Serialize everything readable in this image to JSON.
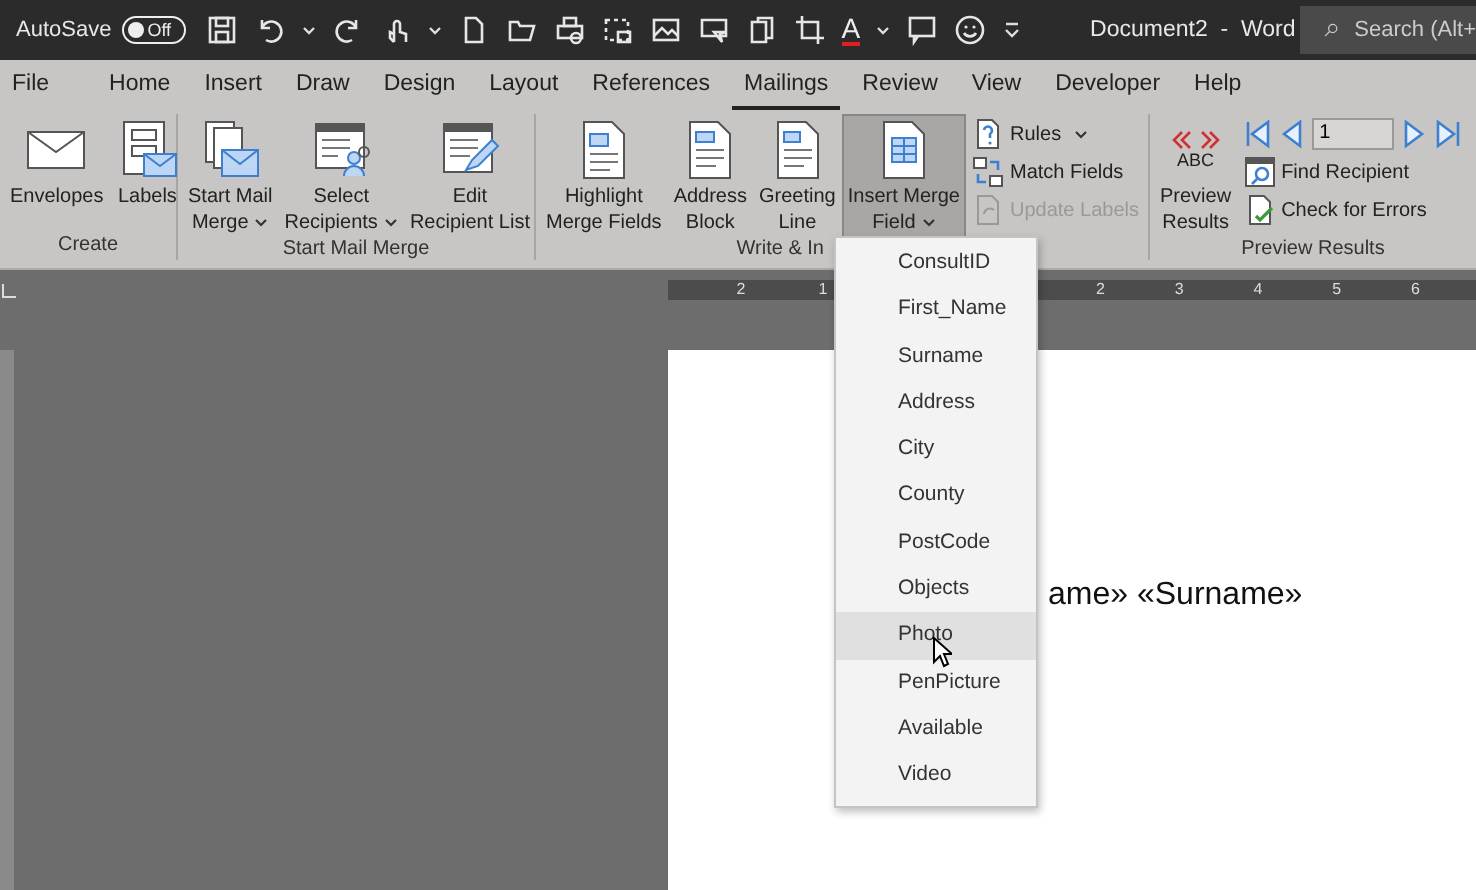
{
  "title_bar": {
    "autosave_label": "AutoSave",
    "autosave": {
      "on": false,
      "label": "Off"
    },
    "font_color_glyph": "A",
    "document_title": "Document2  -  Word",
    "search_placeholder": "Search (Alt+"
  },
  "tabs": [
    {
      "label": "File",
      "selected": false
    },
    {
      "label": "Home",
      "selected": false
    },
    {
      "label": "Insert",
      "selected": false
    },
    {
      "label": "Draw",
      "selected": false
    },
    {
      "label": "Design",
      "selected": false
    },
    {
      "label": "Layout",
      "selected": false
    },
    {
      "label": "References",
      "selected": false
    },
    {
      "label": "Mailings",
      "selected": true
    },
    {
      "label": "Review",
      "selected": false
    },
    {
      "label": "View",
      "selected": false
    },
    {
      "label": "Developer",
      "selected": false
    },
    {
      "label": "Help",
      "selected": false
    }
  ],
  "ribbon": {
    "groups": [
      {
        "label": "Create",
        "buttons": [
          {
            "kind": "large",
            "lines": [
              "Envelopes"
            ],
            "menu": false,
            "pressed": false,
            "disabled": false
          },
          {
            "kind": "large",
            "lines": [
              "Labels"
            ],
            "menu": false,
            "pressed": false,
            "disabled": false
          }
        ]
      },
      {
        "label": "Start Mail Merge",
        "buttons": [
          {
            "kind": "large",
            "lines": [
              "Start Mail",
              "Merge"
            ],
            "menu": true,
            "pressed": false,
            "disabled": false
          },
          {
            "kind": "large",
            "lines": [
              "Select",
              "Recipients"
            ],
            "menu": true,
            "pressed": false,
            "disabled": false
          },
          {
            "kind": "large",
            "lines": [
              "Edit",
              "Recipient List"
            ],
            "menu": false,
            "pressed": false,
            "disabled": false
          }
        ]
      },
      {
        "label": "Write & In",
        "buttons": [
          {
            "kind": "large",
            "lines": [
              "Highlight",
              "Merge Fields"
            ],
            "menu": false,
            "pressed": false,
            "disabled": false
          },
          {
            "kind": "large",
            "lines": [
              "Address",
              "Block"
            ],
            "menu": false,
            "pressed": false,
            "disabled": false
          },
          {
            "kind": "large",
            "lines": [
              "Greeting",
              "Line"
            ],
            "menu": false,
            "pressed": false,
            "disabled": false
          },
          {
            "kind": "large",
            "lines": [
              "Insert Merge",
              "Field"
            ],
            "menu": true,
            "pressed": true,
            "disabled": false
          },
          {
            "kind": "small",
            "lines": [
              "Rules"
            ],
            "menu": true,
            "pressed": false,
            "disabled": false
          },
          {
            "kind": "small",
            "lines": [
              "Match Fields"
            ],
            "menu": false,
            "pressed": false,
            "disabled": false
          },
          {
            "kind": "small",
            "lines": [
              "Update Labels"
            ],
            "menu": false,
            "pressed": false,
            "disabled": true
          }
        ]
      },
      {
        "label": "Preview Results",
        "buttons": [
          {
            "kind": "large",
            "badge": "ABC",
            "lines": [
              "Preview",
              "Results"
            ],
            "menu": false,
            "pressed": false,
            "disabled": false
          },
          {
            "kind": "record",
            "value": "1"
          },
          {
            "kind": "small",
            "lines": [
              "Find Recipient"
            ],
            "menu": false,
            "pressed": false,
            "disabled": false
          },
          {
            "kind": "small",
            "lines": [
              "Check for Errors"
            ],
            "menu": false,
            "pressed": false,
            "disabled": false
          }
        ]
      }
    ]
  },
  "ruler": {
    "left_numbers": [
      "2",
      "1"
    ],
    "right_numbers": [
      "2",
      "3",
      "4",
      "5",
      "6"
    ]
  },
  "document": {
    "text": "ame» «Surname»"
  },
  "merge_field_menu": [
    {
      "label": "ConsultID",
      "selected": false
    },
    {
      "label": "First_Name",
      "selected": false
    },
    {
      "label": "Surname",
      "selected": false
    },
    {
      "label": "Address",
      "selected": false
    },
    {
      "label": "City",
      "selected": false
    },
    {
      "label": "County",
      "selected": false
    },
    {
      "label": "PostCode",
      "selected": false
    },
    {
      "label": "Objects",
      "selected": false
    },
    {
      "label": "Photo",
      "selected": true
    },
    {
      "label": "PenPicture",
      "selected": false
    },
    {
      "label": "Available",
      "selected": false
    },
    {
      "label": "Video",
      "selected": false
    }
  ]
}
